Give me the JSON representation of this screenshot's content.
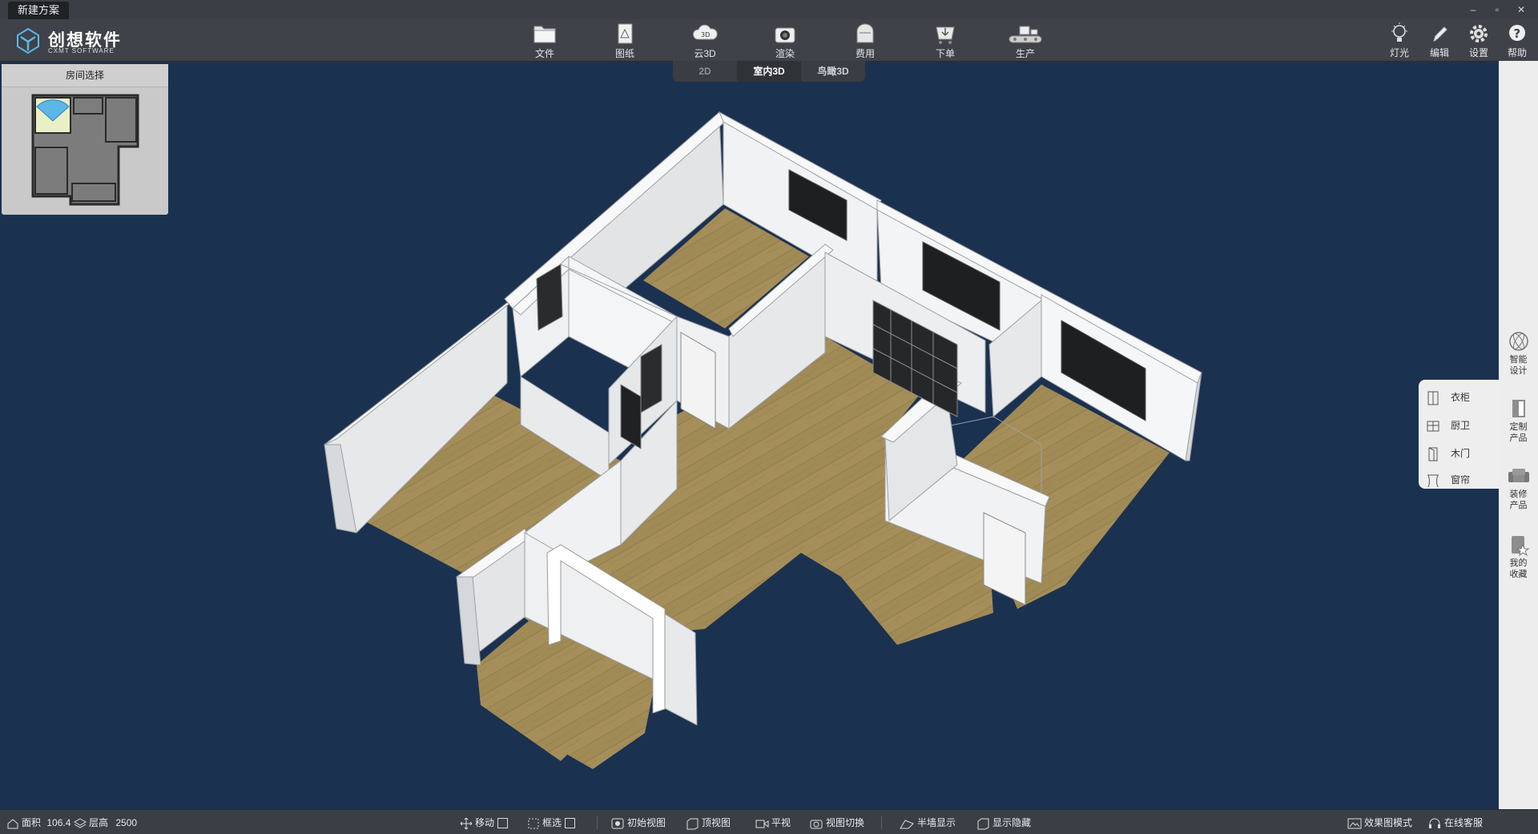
{
  "window": {
    "tab_title": "新建方案",
    "minimize": "–",
    "restore": "▫",
    "close": "✕"
  },
  "logo": {
    "name": "创想软件",
    "sub": "CXMT SOFTWARE"
  },
  "toolbar": {
    "items": [
      {
        "label": "文件",
        "icon": "folder-icon"
      },
      {
        "label": "图纸",
        "icon": "drawing-icon"
      },
      {
        "label": "云3D",
        "icon": "cloud-3d-icon"
      },
      {
        "label": "渲染",
        "icon": "camera-icon"
      },
      {
        "label": "费用",
        "icon": "wallet-icon"
      },
      {
        "label": "下单",
        "icon": "order-icon"
      },
      {
        "label": "生产",
        "icon": "production-icon"
      }
    ],
    "right": [
      {
        "label": "灯光",
        "icon": "lightbulb-icon"
      },
      {
        "label": "编辑",
        "icon": "pen-icon"
      },
      {
        "label": "设置",
        "icon": "gear-icon"
      },
      {
        "label": "帮助",
        "icon": "help-icon"
      }
    ]
  },
  "view_tabs": {
    "tab_2d": "2D",
    "tab_interior": "室内3D",
    "tab_birdseye": "鸟瞰3D",
    "active": "室内3D"
  },
  "room_panel": {
    "title": "房间选择"
  },
  "sidebar": {
    "smart_design": "智能\n设计",
    "custom_products": "定制\n产品",
    "decor_products": "装修\n产品",
    "my_favorites": "我的\n收藏",
    "popup": [
      "衣柜",
      "厨卫",
      "木门",
      "窗帘"
    ]
  },
  "statusbar": {
    "area_label": "面积",
    "area_value": "106.4",
    "height_label": "层高",
    "height_value": "2500",
    "move": "移动",
    "box_select": "框选",
    "initial_view": "初始视图",
    "top_view": "顶视图",
    "level_view": "平视",
    "view_switch": "视图切换",
    "half_wall": "半墙显示",
    "show_hide": "显示隐藏",
    "render_mode": "效果图模式",
    "online_service": "在线客服"
  },
  "colors": {
    "background": "#1b3150",
    "bar": "#3f4248",
    "floor": "#a08a55",
    "wall": "#eceef0"
  }
}
